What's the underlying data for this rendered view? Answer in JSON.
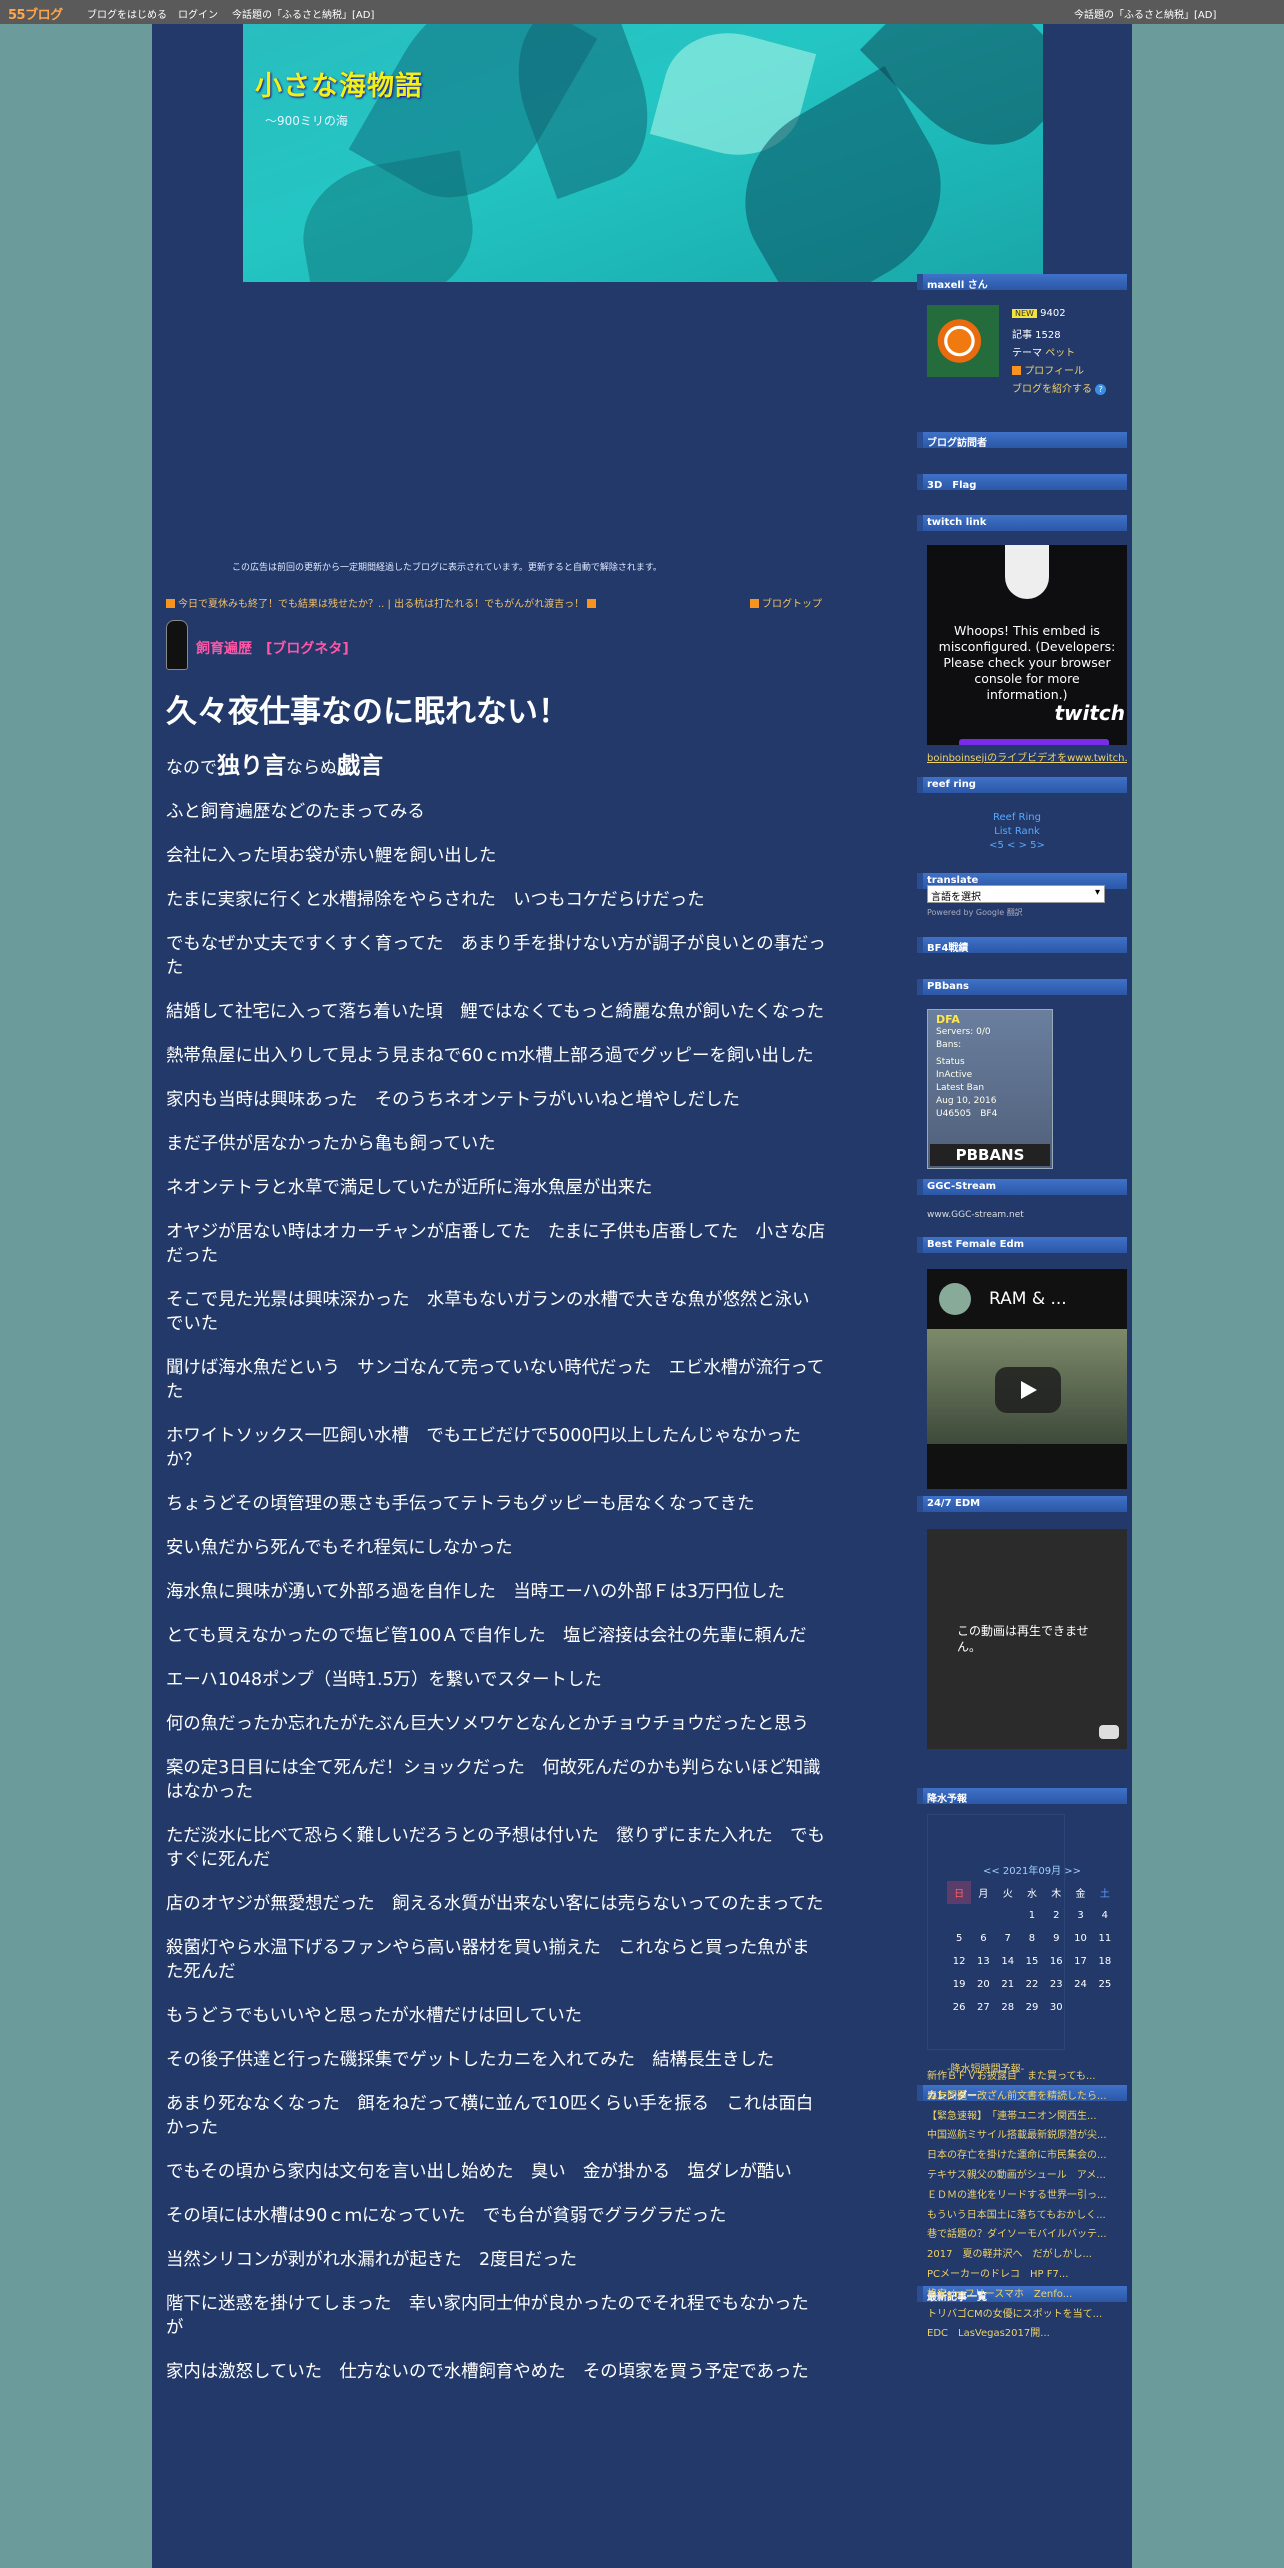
{
  "topbar": {
    "logo": "55ブログ",
    "start_blog": "ブログをはじめる",
    "login": "ログイン",
    "topic_left": "今話題の「ふるさと納税」[AD]",
    "topic_right": "今話題の「ふるさと納税」[AD]"
  },
  "banner": {
    "title": "小さな海物語",
    "subtitle": "～900ミリの海"
  },
  "ad_notice": "この広告は前回の更新から一定期間経過したブログに表示されています。更新すると自動で解除されます。",
  "breadcrumbs": {
    "prev": "今日で夏休みも終了！でも結果は残せたか？..",
    "sep": "|",
    "next": "出る杭は打たれる！でもがんがれ渡吉っ！",
    "top": "ブログトップ"
  },
  "post": {
    "category": "飼育遍歴　[ブログネタ]",
    "title": "久々夜仕事なのに眠れない！",
    "intro": {
      "pre": "なので",
      "b1": "独り言",
      "mid": "ならぬ",
      "b2": "戯言"
    },
    "paragraphs": [
      "ふと飼育遍歴などのたまってみる",
      "会社に入った頃お袋が赤い鯉を飼い出した",
      "たまに実家に行くと水槽掃除をやらされた　いつもコケだらけだった",
      "でもなぜか丈夫ですくすく育ってた　あまり手を掛けない方が調子が良いとの事だった",
      "結婚して社宅に入って落ち着いた頃　鯉ではなくてもっと綺麗な魚が飼いたくなった",
      "熱帯魚屋に出入りして見よう見まねで60ｃｍ水槽上部ろ過でグッピーを飼い出した",
      "家内も当時は興味あった　そのうちネオンテトラがいいねと増やしだした",
      "まだ子供が居なかったから亀も飼っていた",
      "ネオンテトラと水草で満足していたが近所に海水魚屋が出来た",
      "オヤジが居ない時はオカーチャンが店番してた　たまに子供も店番してた　小さな店だった",
      "そこで見た光景は興味深かった　水草もないガランの水槽で大きな魚が悠然と泳いでいた",
      "聞けば海水魚だという　サンゴなんて売っていない時代だった　エビ水槽が流行ってた",
      "ホワイトソックス一匹飼い水槽　でもエビだけで5000円以上したんじゃなかったか？",
      "ちょうどその頃管理の悪さも手伝ってテトラもグッピーも居なくなってきた",
      "安い魚だから死んでもそれ程気にしなかった",
      "海水魚に興味が湧いて外部ろ過を自作した　当時エーハの外部Ｆは3万円位した",
      "とても買えなかったので塩ビ管100Ａで自作した　塩ビ溶接は会社の先輩に頼んだ",
      "エーハ1048ポンプ（当時1.5万）を繋いでスタートした",
      "何の魚だったか忘れたがたぶん巨大ソメワケとなんとかチョウチョウだったと思う",
      "案の定3日目には全て死んだ！ショックだった　何故死んだのかも判らないほど知識はなかった",
      "ただ淡水に比べて恐らく難しいだろうとの予想は付いた　懲りずにまた入れた　でもすぐに死んだ",
      "店のオヤジが無愛想だった　飼える水質が出来ない客には売らないってのたまってた",
      "殺菌灯やら水温下げるファンやら高い器材を買い揃えた　これならと買った魚がまた死んだ",
      "もうどうでもいいやと思ったが水槽だけは回していた",
      "その後子供達と行った磯採集でゲットしたカニを入れてみた　結構長生きした",
      "あまり死ななくなった　餌をねだって横に並んで10匹くらい手を振る　これは面白かった",
      "でもその頃から家内は文句を言い出し始めた　臭い　金が掛かる　塩ダレが酷い",
      "その頃には水槽は90ｃｍになっていた　でも台が貧弱でグラグラだった",
      "当然シリコンが剥がれ水漏れが起きた　2度目だった",
      "階下に迷惑を掛けてしまった　幸い家内同士仲が良かったのでそれ程でもなかったが",
      "家内は激怒していた　仕方ないので水槽飼育やめた　その頃家を買う予定であった"
    ]
  },
  "sidebar": {
    "profile": {
      "header": "maxell さん",
      "badge": "NEW",
      "count": "9402",
      "articles": "記事 1528",
      "theme_label": "テーマ",
      "theme": "ペット",
      "profile_link": "プロフィール",
      "intro_link": "ブログを紹介する"
    },
    "visitors": {
      "header": "ブログ訪問者"
    },
    "flag": {
      "header": "3D　Flag"
    },
    "twitch": {
      "header": "twitch link",
      "msg": "Whoops! This embed is misconfigured. (Developers: Please check your browser console for more information.)",
      "brand": "twitch",
      "link": "boinboinsejiのライブビデオをwww.twitch.tv"
    },
    "reef": {
      "header": "reef ring",
      "l1": "Reef Ring",
      "l2": "List Rank",
      "l3": "<5 < > 5>"
    },
    "translate": {
      "header": "translate",
      "select": "言語を選択",
      "powered": "Powered by",
      "google": "Google",
      "tr": "翻訳"
    },
    "bf4": {
      "header": "BF4戦績"
    },
    "pbbans": {
      "header": "PBbans",
      "dfa": "DFA",
      "servers": "Servers: 0/0",
      "bans": "Bans:",
      "status": "Status",
      "inactive": "InActive",
      "latest": "Latest Ban",
      "date": "Aug 10, 2016",
      "id": "U46505",
      "game": "BF4",
      "logo": "PBBANS"
    },
    "ggc": {
      "header": "GGC-Stream",
      "img": "www.GGC-stream.net"
    },
    "edm": {
      "header": "Best Female Edm",
      "video": "RAM & ..."
    },
    "edm247": {
      "header": "24/7 EDM",
      "msg": "この動画は再生できません。"
    },
    "rain": {
      "header": "降水予報",
      "link": "-降水短時間予報-"
    },
    "calendar": {
      "header": "カレンダー",
      "nav": "<< 2021年09月 >>",
      "dow": [
        "日",
        "月",
        "火",
        "水",
        "木",
        "金",
        "土"
      ],
      "weeks": [
        [
          "",
          "",
          "",
          "1",
          "2",
          "3",
          "4"
        ],
        [
          "5",
          "6",
          "7",
          "8",
          "9",
          "10",
          "11"
        ],
        [
          "12",
          "13",
          "14",
          "15",
          "16",
          "17",
          "18"
        ],
        [
          "19",
          "20",
          "21",
          "22",
          "23",
          "24",
          "25"
        ],
        [
          "26",
          "27",
          "28",
          "29",
          "30",
          "",
          ""
        ]
      ]
    },
    "recent": {
      "header": "最新記事一覧",
      "items": [
        "新作ＢＦＶお披露目　また買っても...",
        "森友問題・改ざん前文書を精読したら...",
        "【緊急速報】　「連帯ユニオン関西生...",
        "中国巡航ミサイル搭載最新鋭原潜が尖...",
        "日本の存亡を掛けた運命に市民集会の...",
        "テキサス親父の動画がシュール　アメ...",
        "ＥＤＭの進化をリードする世界一引っ...",
        "もういう日本国土に落ちてもおかしく...",
        "巷で話題の？ダイソーモバイルバッテ...",
        "2017　夏の軽井沢へ　だがしかし...",
        "PCメーカーのドレコ　HP F7...",
        "格安simフリースマホ　Zenfo...",
        "トリバゴCMの女優にスポットを当て...",
        "EDC　LasVegas2017開..."
      ]
    }
  }
}
